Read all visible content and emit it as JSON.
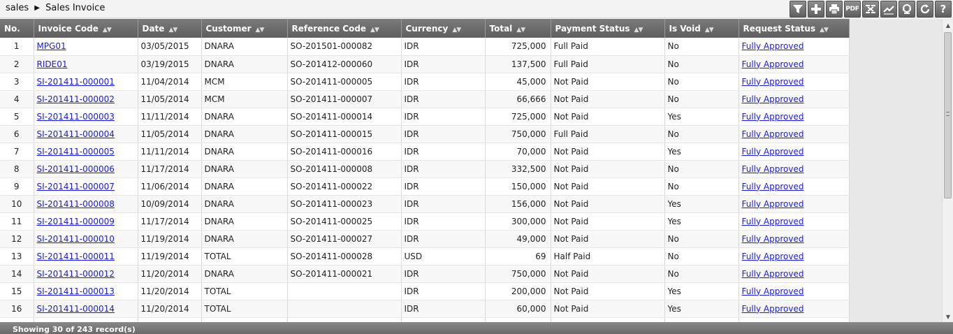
{
  "breadcrumb": {
    "root": "sales",
    "current": "Sales Invoice"
  },
  "toolbar": [
    {
      "name": "filter-icon"
    },
    {
      "name": "add-icon"
    },
    {
      "name": "print-icon"
    },
    {
      "name": "pdf-icon",
      "label": "PDF"
    },
    {
      "name": "excel-icon"
    },
    {
      "name": "chart-icon"
    },
    {
      "name": "support-icon"
    },
    {
      "name": "refresh-icon"
    },
    {
      "name": "help-icon",
      "label": "?"
    }
  ],
  "table": {
    "columns": [
      "No.",
      "Invoice Code",
      "Date",
      "Customer",
      "Reference Code",
      "Currency",
      "Total",
      "Payment Status",
      "Is Void",
      "Request Status"
    ],
    "sort_glyph": "▲▼",
    "rows": [
      [
        "1",
        "MPG01",
        "03/05/2015",
        "DNARA",
        "SO-201501-000082",
        "IDR",
        "725,000",
        "Full Paid",
        "No",
        "Fully Approved"
      ],
      [
        "2",
        "RIDE01",
        "03/19/2015",
        "DNARA",
        "SO-201412-000060",
        "IDR",
        "137,500",
        "Full Paid",
        "No",
        "Fully Approved"
      ],
      [
        "3",
        "SI-201411-000001",
        "11/04/2014",
        "MCM",
        "SO-201411-000005",
        "IDR",
        "45,000",
        "Not Paid",
        "No",
        "Fully Approved"
      ],
      [
        "4",
        "SI-201411-000002",
        "11/05/2014",
        "MCM",
        "SO-201411-000007",
        "IDR",
        "66,666",
        "Not Paid",
        "No",
        "Fully Approved"
      ],
      [
        "5",
        "SI-201411-000003",
        "11/11/2014",
        "DNARA",
        "SO-201411-000014",
        "IDR",
        "725,000",
        "Not Paid",
        "Yes",
        "Fully Approved"
      ],
      [
        "6",
        "SI-201411-000004",
        "11/05/2014",
        "DNARA",
        "SO-201411-000015",
        "IDR",
        "750,000",
        "Full Paid",
        "No",
        "Fully Approved"
      ],
      [
        "7",
        "SI-201411-000005",
        "11/11/2014",
        "DNARA",
        "SO-201411-000016",
        "IDR",
        "70,000",
        "Not Paid",
        "Yes",
        "Fully Approved"
      ],
      [
        "8",
        "SI-201411-000006",
        "11/17/2014",
        "DNARA",
        "SO-201411-000008",
        "IDR",
        "332,500",
        "Not Paid",
        "No",
        "Fully Approved"
      ],
      [
        "9",
        "SI-201411-000007",
        "11/06/2014",
        "DNARA",
        "SO-201411-000022",
        "IDR",
        "150,000",
        "Not Paid",
        "No",
        "Fully Approved"
      ],
      [
        "10",
        "SI-201411-000008",
        "10/09/2014",
        "DNARA",
        "SO-201411-000023",
        "IDR",
        "156,000",
        "Not Paid",
        "Yes",
        "Fully Approved"
      ],
      [
        "11",
        "SI-201411-000009",
        "11/17/2014",
        "DNARA",
        "SO-201411-000025",
        "IDR",
        "300,000",
        "Not Paid",
        "Yes",
        "Fully Approved"
      ],
      [
        "12",
        "SI-201411-000010",
        "11/19/2014",
        "DNARA",
        "SO-201411-000027",
        "IDR",
        "49,000",
        "Not Paid",
        "No",
        "Fully Approved"
      ],
      [
        "13",
        "SI-201411-000011",
        "11/19/2014",
        "TOTAL",
        "SO-201411-000028",
        "USD",
        "69",
        "Half Paid",
        "No",
        "Fully Approved"
      ],
      [
        "14",
        "SI-201411-000012",
        "11/20/2014",
        "DNARA",
        "SO-201411-000021",
        "IDR",
        "750,000",
        "Not Paid",
        "No",
        "Fully Approved"
      ],
      [
        "15",
        "SI-201411-000013",
        "11/20/2014",
        "TOTAL",
        "",
        "IDR",
        "200,000",
        "Not Paid",
        "Yes",
        "Fully Approved"
      ],
      [
        "16",
        "SI-201411-000014",
        "11/20/2014",
        "TOTAL",
        "",
        "IDR",
        "60,000",
        "Not Paid",
        "Yes",
        "Fully Approved"
      ],
      [
        "",
        "",
        "",
        "",
        "",
        "",
        "",
        "",
        "",
        ""
      ]
    ]
  },
  "footer": {
    "status": "Showing 30 of 243 record(s)"
  }
}
